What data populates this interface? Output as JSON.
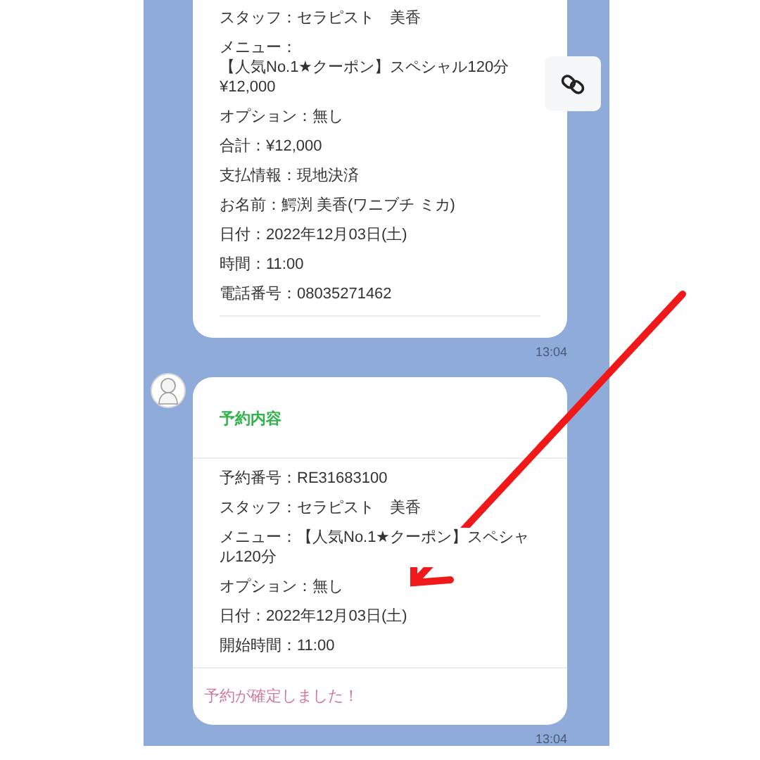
{
  "messages": [
    {
      "avatar": false,
      "rows": [
        [
          "スタッフ：セラピスト　美香"
        ],
        [
          "メニュー：",
          "【人気No.1★クーポン】スペシャル120分",
          "¥12,000"
        ],
        [
          "オプション：無し"
        ],
        [
          "合計：¥12,000"
        ],
        [
          "支払情報：現地決済"
        ],
        [
          "お名前：鰐渕 美香(ワニブチ ミカ)"
        ],
        [
          "日付：2022年12月03日(土)"
        ],
        [
          "時間：11:00"
        ],
        [
          "電話番号：08035271462"
        ]
      ],
      "time": "13:04"
    },
    {
      "avatar": true,
      "title": "予約内容",
      "rows": [
        [
          "予約番号：RE31683100"
        ],
        [
          "スタッフ：セラピスト　美香"
        ],
        [
          "メニュー：【人気No.1★クーポン】スペシャル120分"
        ],
        [
          "オプション：無し"
        ],
        [
          "日付：2022年12月03日(土)"
        ],
        [
          "開始時間：11:00"
        ]
      ],
      "footer": "予約が確定しました！",
      "time": "13:04"
    }
  ]
}
